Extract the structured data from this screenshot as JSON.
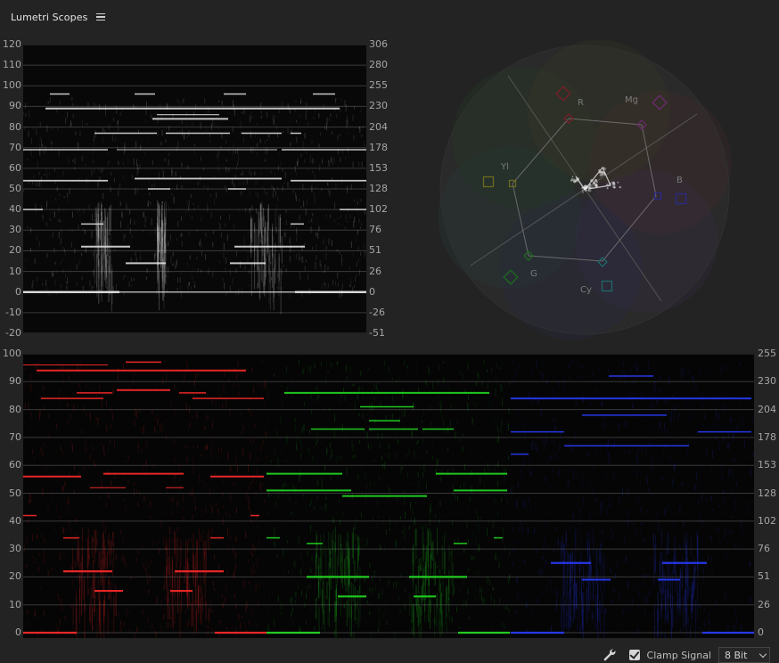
{
  "panel": {
    "title": "Lumetri Scopes"
  },
  "luma_waveform": {
    "left_ticks": [
      "120",
      "110",
      "100",
      "90",
      "80",
      "70",
      "60",
      "50",
      "40",
      "30",
      "20",
      "10",
      "0",
      "-10",
      "-20"
    ],
    "right_ticks": [
      "306",
      "280",
      "255",
      "230",
      "204",
      "178",
      "153",
      "128",
      "102",
      "76",
      "51",
      "26",
      "0",
      "-26",
      "-51"
    ]
  },
  "rgb_parade": {
    "left_ticks": [
      "100",
      "90",
      "80",
      "70",
      "60",
      "50",
      "40",
      "30",
      "20",
      "10",
      "0"
    ],
    "right_ticks": [
      "255",
      "230",
      "204",
      "178",
      "153",
      "128",
      "102",
      "76",
      "51",
      "26",
      "0"
    ],
    "colors": {
      "red": "#ff2a2a",
      "green": "#22dd22",
      "blue": "#2a3cff"
    }
  },
  "vectorscope": {
    "labels": {
      "r": "R",
      "mg": "Mg",
      "b": "B",
      "cy": "Cy",
      "g": "G",
      "yl": "Yl"
    }
  },
  "footer": {
    "clamp_label": "Clamp Signal",
    "clamp_checked": true,
    "bit_depth": "8 Bit"
  }
}
